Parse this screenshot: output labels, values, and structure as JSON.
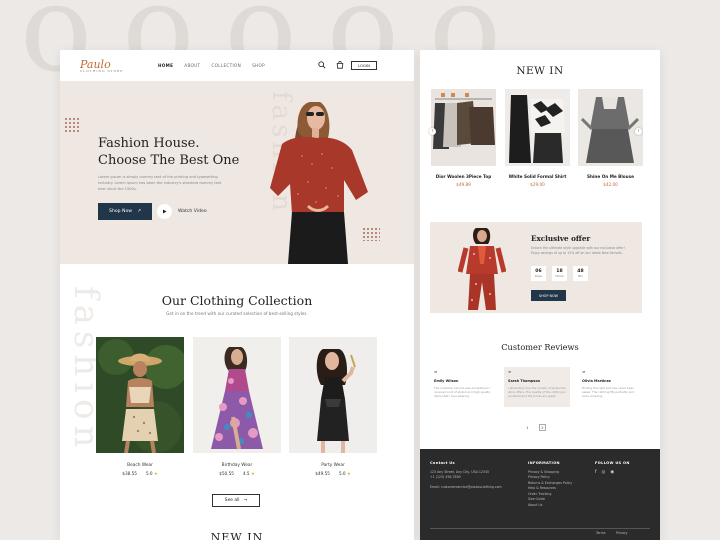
{
  "header": {
    "logo": "Paulo",
    "logo_sub": "CLOTHING STORE",
    "nav": [
      "HOME",
      "ABOUT",
      "COLLECTION",
      "SHOP"
    ],
    "login": "LOGIN"
  },
  "hero": {
    "title_line1": "Fashion House.",
    "title_line2": "Choose The Best One",
    "description": "Lorem ipsum is simply dummy text of the printing and typesetting industry. Lorem ipsum has been the industry's standard dummy text ever since the 1500s.",
    "shop_button": "Shop Now",
    "watch_label": "Watch Video",
    "vertical_text": "fashion"
  },
  "collection": {
    "title": "Our Clothing Collection",
    "subtitle": "Get in on the trend with our curated selection of best-selling styles.",
    "vertical_text": "fashion",
    "items": [
      {
        "name": "Beach Wear",
        "price": "$38.55",
        "rating": "5.0",
        "star": "★"
      },
      {
        "name": "Birthday Wear",
        "price": "$50.55",
        "rating": "4.5",
        "star": "★"
      },
      {
        "name": "Party  Wear",
        "price": "$49.55",
        "rating": "5.0",
        "star": "★"
      }
    ],
    "see_all": "See all",
    "next_section_title": "NEW IN"
  },
  "new_in": {
    "title": "NEW IN",
    "products": [
      {
        "name": "Dior Woolen 3Piece Top",
        "price": "$49.89"
      },
      {
        "name": "White Solid Formal Shirt",
        "price": "$29.00"
      },
      {
        "name": "Shine On Me Blouse",
        "price": "$42.00"
      }
    ]
  },
  "offer": {
    "title": "Exclusive offer",
    "description": "Unlock the ultimate style upgrade with our exclusive offer! Enjoy savings of up to 15% off on our latest New Arrivals.",
    "timer": [
      {
        "value": "06",
        "unit": "Days"
      },
      {
        "value": "18",
        "unit": "Hours"
      },
      {
        "value": "48",
        "unit": "Min"
      }
    ],
    "button": "SHOP NOW"
  },
  "reviews": {
    "title": "Customer Reviews",
    "items": [
      {
        "name": "Emily Wilson",
        "text": "The customer service was exceptional. I received a lot of stylish and high quality items that I love wearing."
      },
      {
        "name": "Sarah Thompson",
        "text": "I absolutely love the variety of styles this store offers. The quality of the clothing is excellent and the prices are great."
      },
      {
        "name": "Olivia Martinez",
        "text": "Finding the right size has never been easier. The clothing fits perfectly and looks amazing."
      }
    ],
    "pages": [
      "1",
      "2"
    ]
  },
  "footer": {
    "contact_heading": "Contact Us",
    "contact_lines": [
      "123 Any Street, Any City, USA 12345",
      "+1 (123) 456-7890"
    ],
    "email": "Email: customerservice@paulosclothing.com",
    "info_heading": "INFORMATION",
    "info_links": [
      "Privacy & Shopping",
      "Privacy Policy",
      "Returns & Exchanges Policy",
      "Help & Resources",
      "Order Tracking",
      "Size Guide",
      "About Us"
    ],
    "follow_heading": "FOLLOW US ON",
    "social": [
      "f",
      "◎",
      "◉"
    ],
    "bottom_links": [
      "Terms",
      "Privacy"
    ]
  },
  "colors": {
    "accent": "#c26a33",
    "navy": "#213648",
    "hero_bg": "#efe7e2",
    "footer_bg": "#2b2b2b"
  }
}
